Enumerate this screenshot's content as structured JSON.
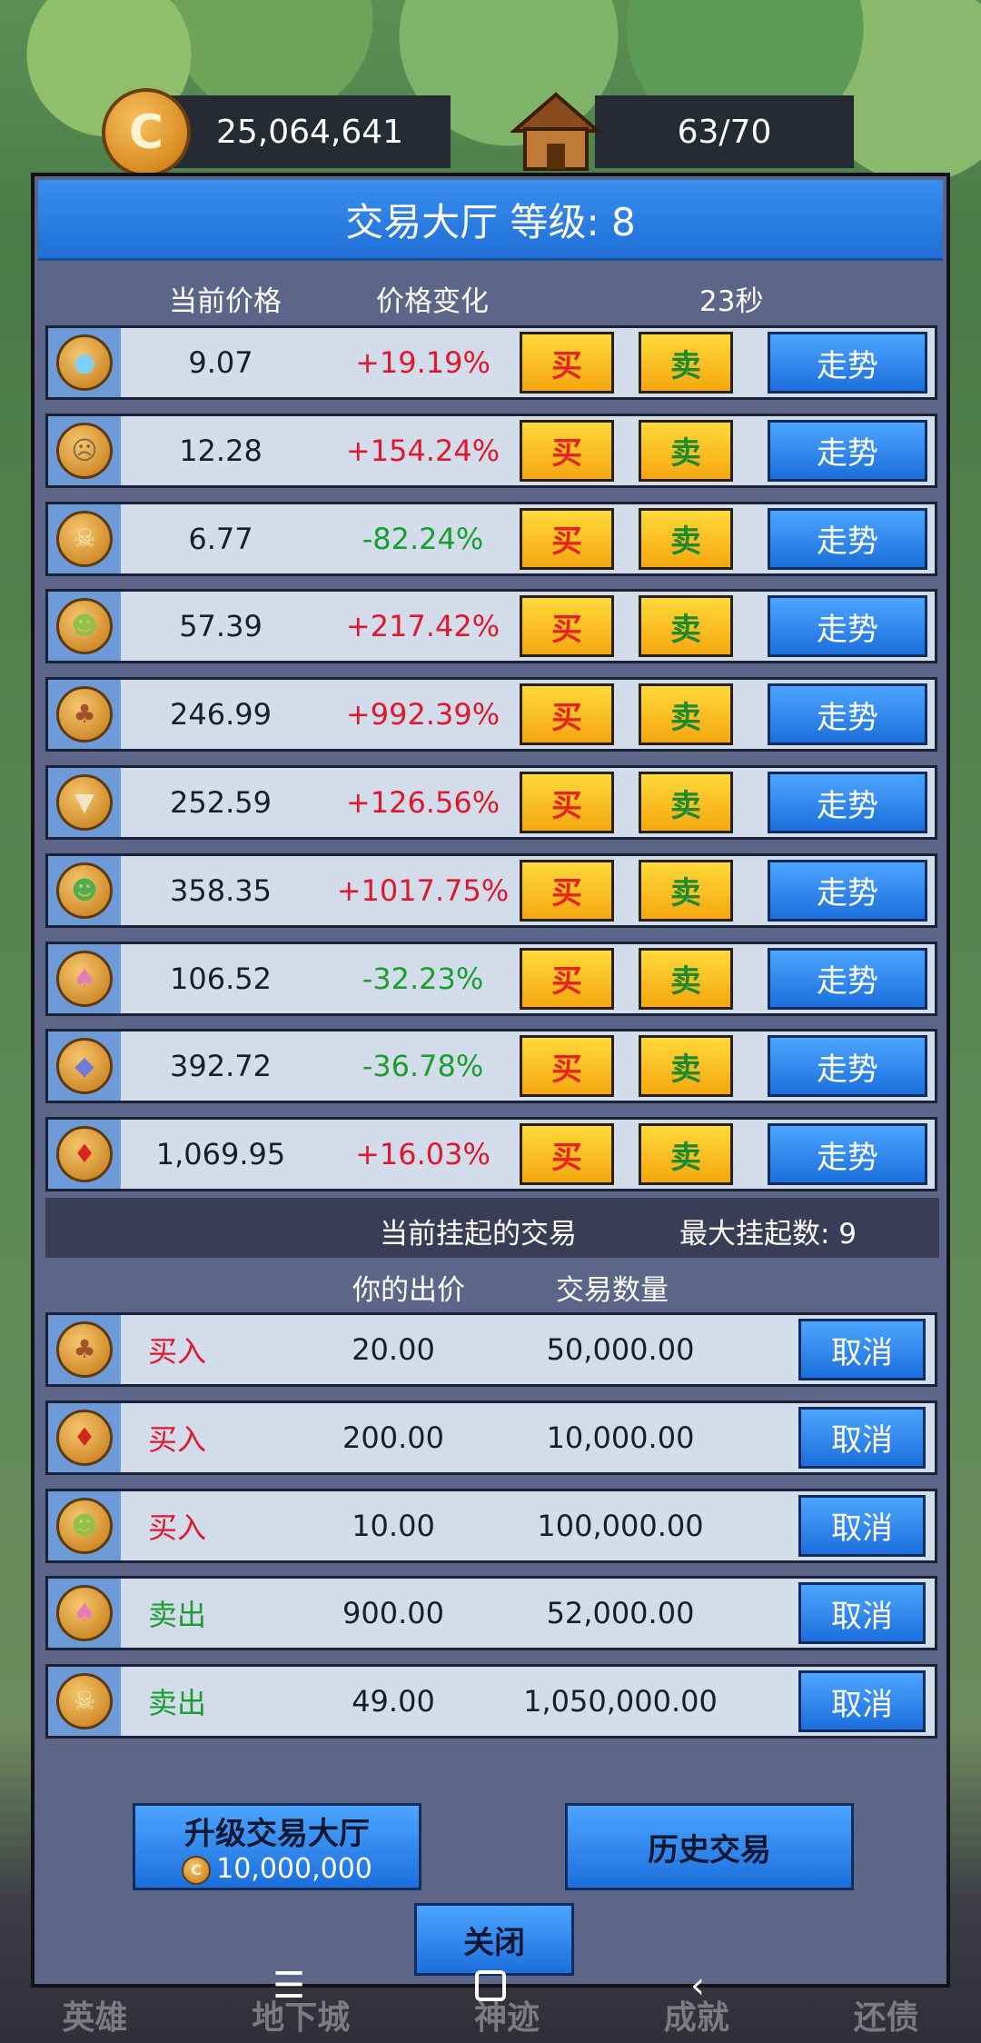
{
  "header": {
    "gold": "25,064,641",
    "capacity": "63/70"
  },
  "hall": {
    "title": "交易大厅 等级: 8",
    "col_price": "当前价格",
    "col_change": "价格变化",
    "timer": "23秒",
    "buy_label": "买",
    "sell_label": "卖",
    "trend_label": "走势",
    "items": [
      {
        "icon": "slime-icon",
        "glyph": "●",
        "glyph_color": "#7fd0f5",
        "price": "9.07",
        "change": "+19.19%",
        "dir": "up"
      },
      {
        "icon": "zombie-icon",
        "glyph": "☹",
        "glyph_color": "#7b6a4a",
        "price": "12.28",
        "change": "+154.24%",
        "dir": "up"
      },
      {
        "icon": "skull-icon",
        "glyph": "☠",
        "glyph_color": "#f7e9b0",
        "price": "6.77",
        "change": "-82.24%",
        "dir": "down"
      },
      {
        "icon": "goblin-icon",
        "glyph": "☻",
        "glyph_color": "#8bc34a",
        "price": "57.39",
        "change": "+217.42%",
        "dir": "up"
      },
      {
        "icon": "treant-icon",
        "glyph": "♣",
        "glyph_color": "#a0522d",
        "price": "246.99",
        "change": "+992.39%",
        "dir": "up"
      },
      {
        "icon": "wolf-icon",
        "glyph": "▼",
        "glyph_color": "#f3e6c8",
        "price": "252.59",
        "change": "+126.56%",
        "dir": "up"
      },
      {
        "icon": "orc-icon",
        "glyph": "☻",
        "glyph_color": "#4caf50",
        "price": "358.35",
        "change": "+1017.75%",
        "dir": "up"
      },
      {
        "icon": "mushroom-icon",
        "glyph": "♠",
        "glyph_color": "#e57bb7",
        "price": "106.52",
        "change": "-32.23%",
        "dir": "down"
      },
      {
        "icon": "bat-icon",
        "glyph": "◆",
        "glyph_color": "#6f7bd6",
        "price": "392.72",
        "change": "-36.78%",
        "dir": "down"
      },
      {
        "icon": "dragon-icon",
        "glyph": "♦",
        "glyph_color": "#d7261e",
        "price": "1,069.95",
        "change": "+16.03%",
        "dir": "up"
      }
    ]
  },
  "pending": {
    "title": "当前挂起的交易",
    "max": "最大挂起数:  9",
    "col_bid": "你的出价",
    "col_qty": "交易数量",
    "cancel_label": "取消",
    "orders": [
      {
        "icon": "treant-icon",
        "glyph": "♣",
        "glyph_color": "#a0522d",
        "type": "买入",
        "kind": "buy",
        "price": "20.00",
        "qty": "50,000.00"
      },
      {
        "icon": "dragon-icon",
        "glyph": "♦",
        "glyph_color": "#d7261e",
        "type": "买入",
        "kind": "buy",
        "price": "200.00",
        "qty": "10,000.00"
      },
      {
        "icon": "goblin-icon",
        "glyph": "☻",
        "glyph_color": "#8bc34a",
        "type": "买入",
        "kind": "buy",
        "price": "10.00",
        "qty": "100,000.00"
      },
      {
        "icon": "mushroom-icon",
        "glyph": "♠",
        "glyph_color": "#e57bb7",
        "type": "卖出",
        "kind": "sell",
        "price": "900.00",
        "qty": "52,000.00"
      },
      {
        "icon": "skull-icon",
        "glyph": "☠",
        "glyph_color": "#f7e9b0",
        "type": "卖出",
        "kind": "sell",
        "price": "49.00",
        "qty": "1,050,000.00"
      }
    ]
  },
  "actions": {
    "upgrade_label": "升级交易大厅",
    "upgrade_cost": "10,000,000",
    "history_label": "历史交易",
    "close_label": "关闭"
  },
  "bottom_nav": [
    "英雄",
    "地下城",
    "神迹",
    "成就",
    "还债"
  ],
  "colors": {
    "up": "#e0182c",
    "down": "#1a9e2e",
    "buy_order": "#e0182c",
    "sell_order": "#1a9e2e"
  }
}
